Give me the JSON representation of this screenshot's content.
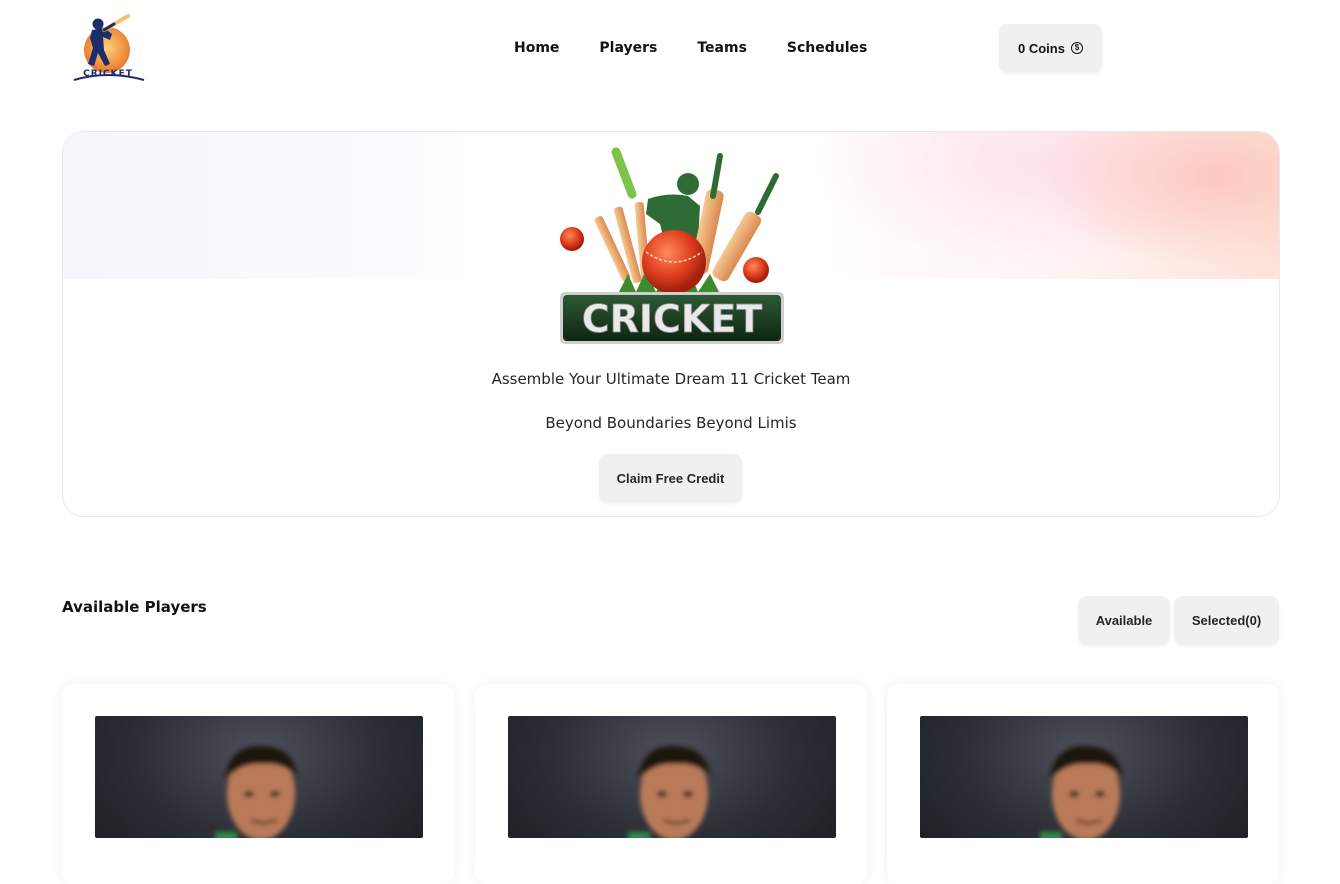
{
  "nav": {
    "logo_text": "CRICKET",
    "links": [
      {
        "label": "Home"
      },
      {
        "label": "Players"
      },
      {
        "label": "Teams"
      },
      {
        "label": "Schedules"
      }
    ],
    "coins_label": "0 Coins",
    "coin_icon": "dollar-coin-icon"
  },
  "banner": {
    "logo_text": "CRICKET",
    "title": "Assemble Your Ultimate Dream 11 Cricket Team",
    "subtitle": "Beyond Boundaries Beyond Limis",
    "cta_label": "Claim Free Credit"
  },
  "players_section": {
    "title": "Available Players",
    "toggle_available": "Available",
    "toggle_selected": "Selected(0)"
  },
  "colors": {
    "button_bg": "#f0f0f0",
    "text": "#131313",
    "banner_gradient_accent": "#fde3d8",
    "logo_orange": "#f2a03d",
    "logo_navy": "#1d2c6b",
    "ball_red": "#d7361e",
    "badge_green": "#17351e"
  }
}
